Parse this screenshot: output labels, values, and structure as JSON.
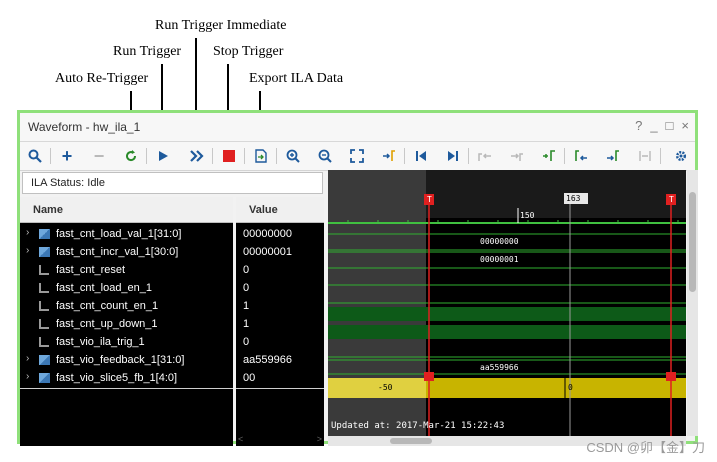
{
  "callouts": {
    "run_trigger_immediate": "Run Trigger Immediate",
    "run_trigger": "Run Trigger",
    "stop_trigger": "Stop Trigger",
    "auto_retrigger": "Auto Re-Trigger",
    "export_ila": "Export ILA Data"
  },
  "window": {
    "title": "Waveform - hw_ila_1",
    "help": "?",
    "minimize": "_",
    "maximize": "□",
    "close": "×"
  },
  "status": {
    "text": "ILA Status: Idle"
  },
  "columns": {
    "name": "Name",
    "value": "Value"
  },
  "signals": [
    {
      "name": "fast_cnt_load_val_1[31:0]",
      "value": "00000000",
      "kind": "bus",
      "expandable": true
    },
    {
      "name": "fast_cnt_incr_val_1[30:0]",
      "value": "00000001",
      "kind": "bus",
      "expandable": true
    },
    {
      "name": "fast_cnt_reset",
      "value": "0",
      "kind": "bit",
      "expandable": false
    },
    {
      "name": "fast_cnt_load_en_1",
      "value": "0",
      "kind": "bit",
      "expandable": false
    },
    {
      "name": "fast_cnt_count_en_1",
      "value": "1",
      "kind": "bit",
      "expandable": false
    },
    {
      "name": "fast_cnt_up_down_1",
      "value": "1",
      "kind": "bit",
      "expandable": false
    },
    {
      "name": "fast_vio_ila_trig_1",
      "value": "0",
      "kind": "bit",
      "expandable": false
    },
    {
      "name": "fast_vio_feedback_1[31:0]",
      "value": "aa559966",
      "kind": "bus",
      "expandable": true
    },
    {
      "name": "fast_vio_slice5_fb_1[4:0]",
      "value": "00",
      "kind": "bus",
      "expandable": true
    }
  ],
  "waveform": {
    "cursor_label": "163",
    "tick_label": "150",
    "marker_t": "T",
    "bus_texts": [
      "00000000",
      "00000001",
      "aa559966"
    ],
    "bottom_left": "-50",
    "bottom_mid": "0",
    "updated": "Updated at: 2017-Mar-21 15:22:43"
  },
  "scroll": {
    "left": "<",
    "right": ">"
  },
  "watermark": "CSDN @卯【金】刀",
  "colors": {
    "frame": "#8fe07a",
    "trigger_marker": "#e02020",
    "stop_button": "#e02020",
    "wave_green": "#20c020",
    "slice_bar": "#e0d020"
  }
}
